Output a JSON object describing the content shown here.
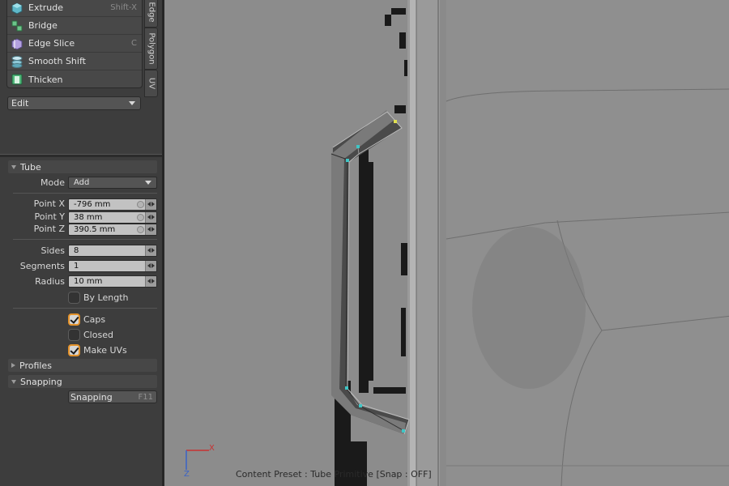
{
  "tools": [
    {
      "label": "Extrude",
      "shortcut": "Shift-X",
      "icon": "extrude-icon"
    },
    {
      "label": "Bridge",
      "shortcut": "",
      "icon": "bridge-icon"
    },
    {
      "label": "Edge Slice",
      "shortcut": "C",
      "icon": "edge-slice-icon"
    },
    {
      "label": "Smooth Shift",
      "shortcut": "",
      "icon": "smooth-shift-icon"
    },
    {
      "label": "Thicken",
      "shortcut": "",
      "icon": "thicken-icon"
    }
  ],
  "side_tabs": [
    "Edge",
    "Polygon",
    "UV"
  ],
  "edit_dropdown": {
    "value": "Edit"
  },
  "tube": {
    "section": "Tube",
    "mode_label": "Mode",
    "mode_value": "Add",
    "point_x_label": "Point X",
    "point_x": "-796 mm",
    "point_y_label": "Point Y",
    "point_y": "38 mm",
    "point_z_label": "Point Z",
    "point_z": "390.5 mm",
    "sides_label": "Sides",
    "sides": "8",
    "segments_label": "Segments",
    "segments": "1",
    "radius_label": "Radius",
    "radius": "10 mm",
    "by_length_label": "By Length",
    "caps_label": "Caps",
    "closed_label": "Closed",
    "make_uvs_label": "Make UVs",
    "checkbox_states": {
      "by_length": false,
      "caps": true,
      "closed": false,
      "make_uvs": true
    }
  },
  "profiles_section": "Profiles",
  "snapping_section": "Snapping",
  "snapping_button": {
    "label": "Snapping",
    "shortcut": "F11"
  },
  "viewport": {
    "status_text": "Content Preset : Tube Primitive  [Snap : OFF]",
    "axis_x": "X",
    "axis_z": "Z"
  },
  "colors": {
    "accent": "#e3922b",
    "handle": "#3fc6c6",
    "axis_x": "#c83232",
    "axis_z": "#3a63c8"
  }
}
